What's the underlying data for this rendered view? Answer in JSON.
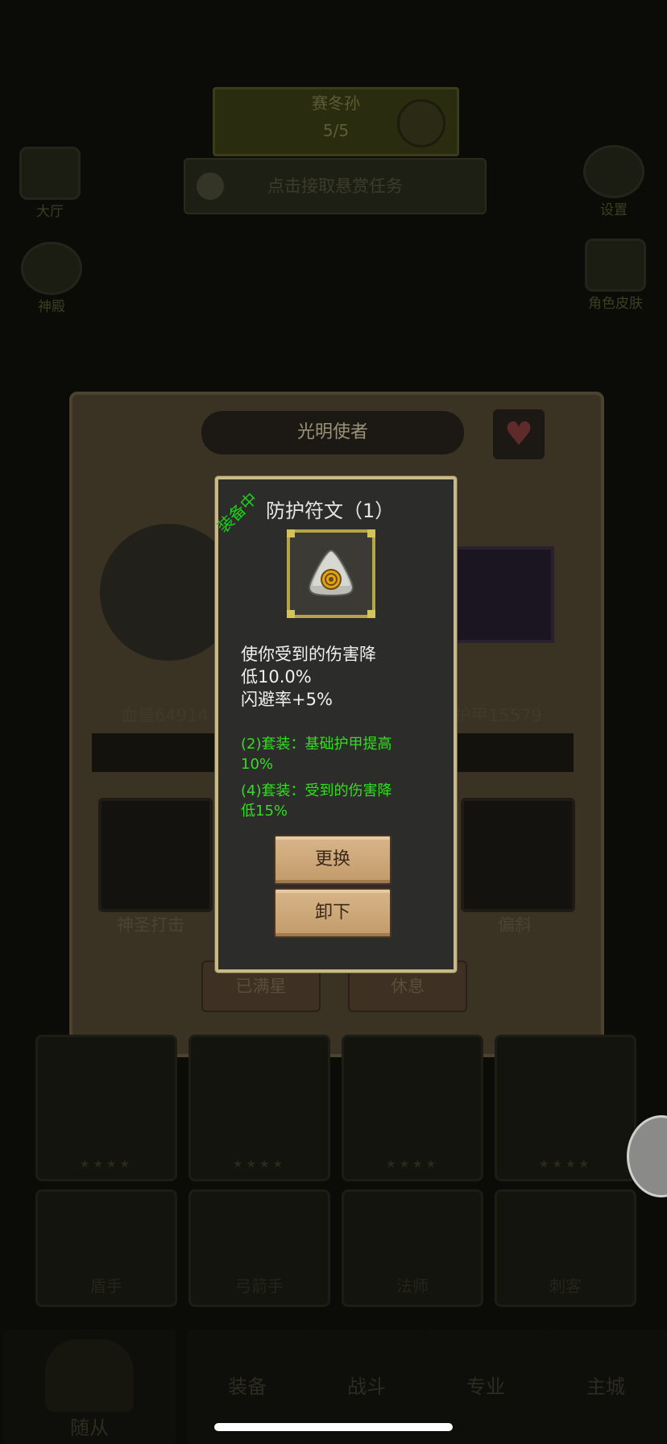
{
  "background": {
    "top_task": {
      "line1": "赛冬孙",
      "line2": "5/5"
    },
    "bounty_text": "点击接取悬赏任务",
    "left_icons": [
      "大厅",
      "神殿"
    ],
    "right_icons": [
      "设置",
      "角色皮肤"
    ],
    "panel": {
      "title": "光明使者",
      "hp_stat": "血量64914",
      "armor_stat": "护甲15579",
      "skills": [
        "神圣打击",
        "偏斜"
      ],
      "buttons": [
        "已满星",
        "休息"
      ]
    },
    "hero_stars": "★★★★",
    "bottom_row_labels": [
      "盾手",
      "弓箭手",
      "法师",
      "刺客"
    ],
    "tabs": [
      "随从",
      "装备",
      "战斗",
      "专业",
      "主城"
    ]
  },
  "popup": {
    "equipped_tag": "装备中",
    "title": "防护符文（1）",
    "description": [
      "使你受到的伤害降",
      "低10.0%",
      "闪避率+5%"
    ],
    "set_bonus_2": [
      "(2)套装：基础护甲提高",
      "10%"
    ],
    "set_bonus_4": [
      "(4)套装：受到的伤害降",
      "低15%"
    ],
    "replace_button": "更换",
    "unequip_button": "卸下"
  }
}
